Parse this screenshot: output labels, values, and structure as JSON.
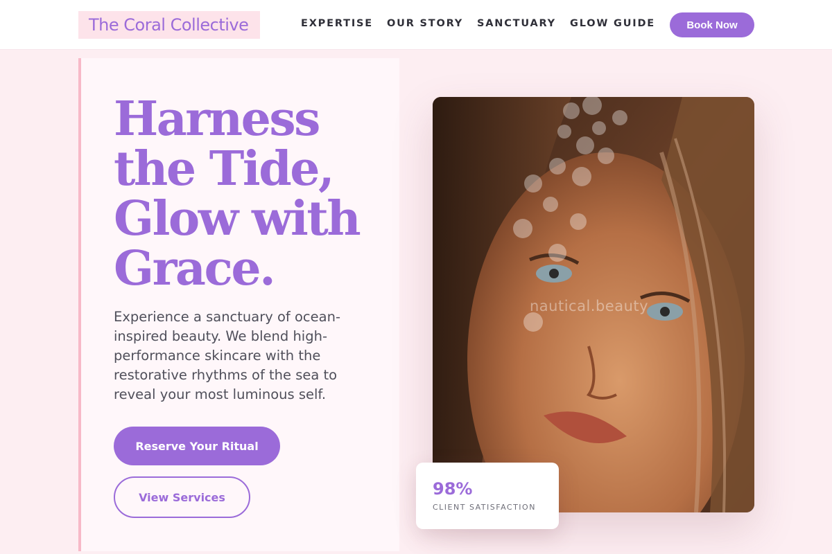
{
  "header": {
    "brand": "The Coral Collective",
    "nav": [
      "EXPERTISE",
      "OUR STORY",
      "SANCTUARY",
      "GLOW GUIDE"
    ],
    "cta": "Book Now"
  },
  "hero": {
    "headline_lines": [
      "Harness",
      "the Tide,",
      "Glow with",
      "Grace."
    ],
    "description_lines": [
      "Experience a sanctuary of ocean-",
      "inspired beauty. We blend high-",
      "performance skincare with the",
      "restorative rhythms of the sea to",
      "reveal your most luminous self."
    ],
    "primary_cta": "Reserve Your Ritual",
    "secondary_cta": "View Services"
  },
  "image": {
    "watermark": "nautical.beauty"
  },
  "stat": {
    "value": "98%",
    "label": "CLIENT SATISFACTION"
  },
  "colors": {
    "accent": "#9b6bd9",
    "page_background": "#fdeef2",
    "card_border": "#f7b9c8"
  }
}
